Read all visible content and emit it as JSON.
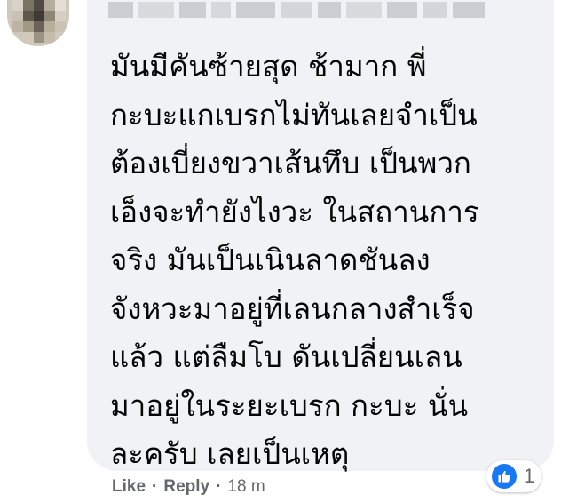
{
  "comment": {
    "lines": [
      "มันมีคันซ้ายสุด ช้ามาก พี่",
      "กะบะแกเบรกไม่ทันเลยจำเป็น",
      "ต้องเบี่ยงขวาเส้นทึบ เป็นพวก",
      "เอ็งจะทำยังไงวะ ในสถานการ",
      "จริง มันเป็นเนินลาดชันลง",
      "จังหวะมาอยู่ที่เลนกลางสำเร็จ",
      "แล้ว แต่ลืมโบ ดันเปลี่ยนเลน",
      "มาอยู่ในระยะเบรก กะบะ นั่น",
      "ละครับ เลยเป็นเหตุ"
    ]
  },
  "actions": {
    "like_label": "Like",
    "separator": "·",
    "reply_label": "Reply",
    "timestamp": "18 m"
  },
  "reactions": {
    "icon": "like-icon",
    "count": "1",
    "color": "#1877f2"
  },
  "colors": {
    "bubble": "#f0f2f5",
    "text": "#050505",
    "meta": "#65676b"
  }
}
